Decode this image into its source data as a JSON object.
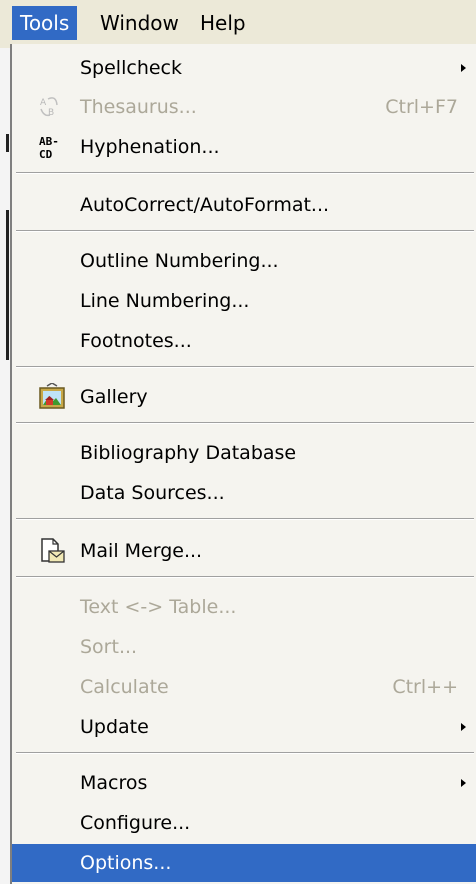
{
  "menubar": {
    "tools": "Tools",
    "window": "Window",
    "help": "Help"
  },
  "menu": {
    "spellcheck": "Spellcheck",
    "thesaurus": "Thesaurus...",
    "thesaurus_shortcut": "Ctrl+F7",
    "hyphenation": "Hyphenation...",
    "autocorrect": "AutoCorrect/AutoFormat...",
    "outline_numbering": "Outline Numbering...",
    "line_numbering": "Line Numbering...",
    "footnotes": "Footnotes...",
    "gallery": "Gallery",
    "bibliography": "Bibliography Database",
    "data_sources": "Data Sources...",
    "mail_merge": "Mail Merge...",
    "text_table": "Text <-> Table...",
    "sort": "Sort...",
    "calculate": "Calculate",
    "calculate_shortcut": "Ctrl++",
    "update": "Update",
    "macros": "Macros",
    "configure": "Configure...",
    "options": "Options..."
  },
  "icons": {
    "thesaurus": "thesaurus-icon",
    "hyphenation": "hyphenation-icon",
    "gallery": "gallery-icon",
    "mail_merge": "mail-merge-icon",
    "submenu": "submenu-arrow-icon"
  },
  "colors": {
    "highlight": "#316ac5",
    "menu_bg": "#f5f4ef",
    "disabled": "#aca899"
  }
}
